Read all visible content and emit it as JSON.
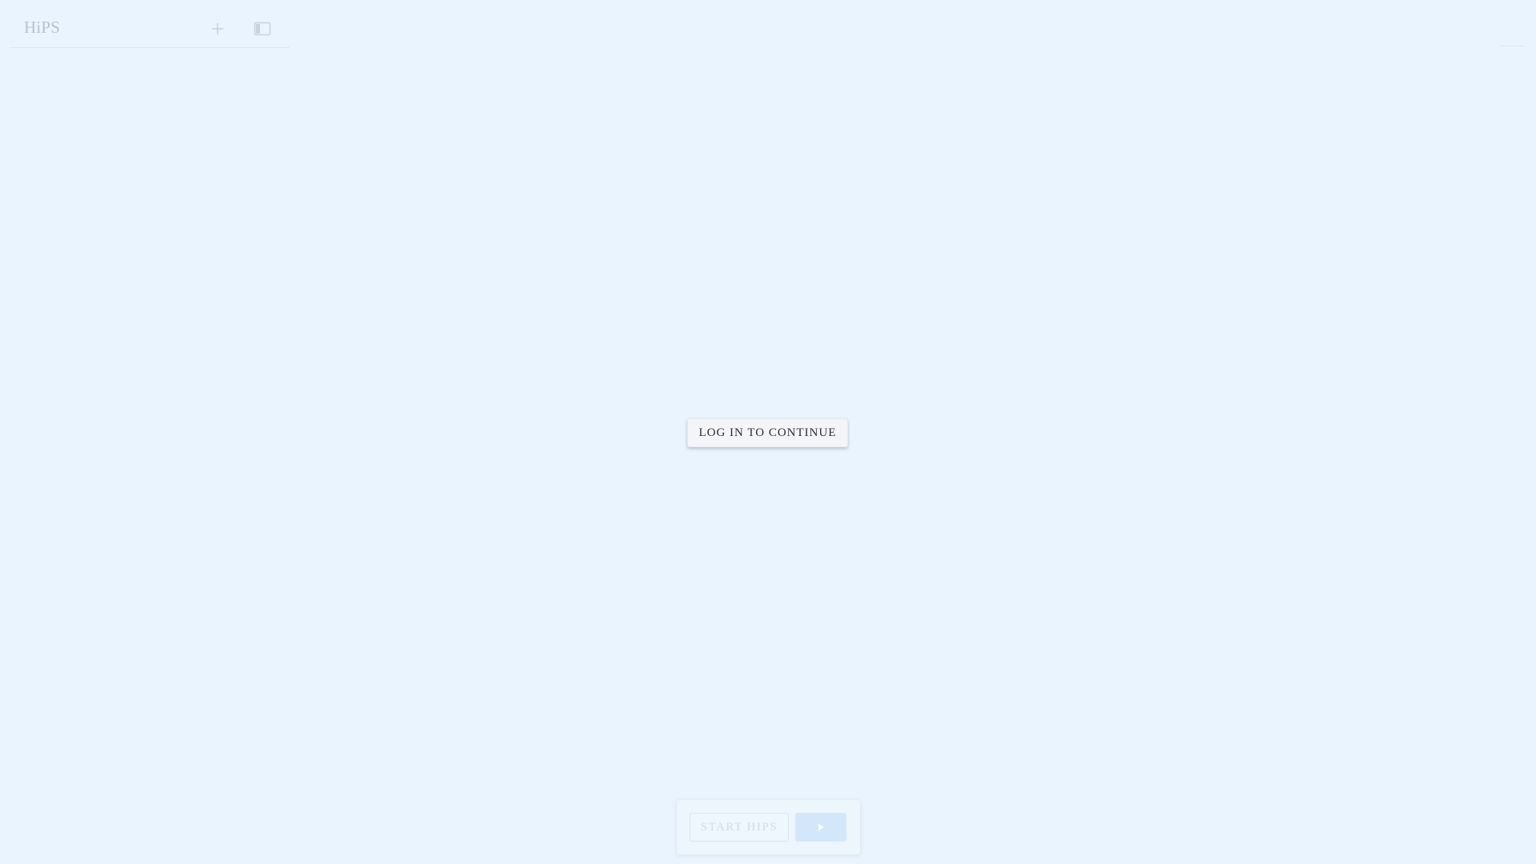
{
  "app": {
    "title": "HiPS"
  },
  "header": {
    "add_icon": "plus-icon",
    "toggle_icon": "sidebar-toggle-icon"
  },
  "main": {
    "login_label": "LOG IN TO CONTINUE"
  },
  "controls": {
    "start_label": "START HIPS",
    "play_icon": "play-icon",
    "start_disabled": true
  },
  "colors": {
    "background": "#eaf4fe",
    "title_text": "#b8c2cc",
    "login_text": "#2b2f33",
    "play_button": "#d4e7fa"
  }
}
